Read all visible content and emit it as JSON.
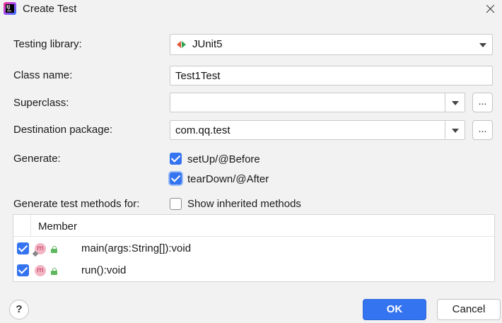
{
  "window": {
    "title": "Create Test",
    "app_icon": "intellij-idea-icon",
    "app_icon_text": "IJ"
  },
  "form": {
    "testing_library_label": "Testing library:",
    "testing_library_value": "JUnit5",
    "class_name_label": "Class name:",
    "class_name_value": "Test1Test",
    "superclass_label": "Superclass:",
    "superclass_value": "",
    "destination_package_label": "Destination package:",
    "destination_package_value": "com.qq.test",
    "browse_label": "...",
    "generate_label": "Generate:",
    "setup_label": "setUp/@Before",
    "setup_checked": true,
    "teardown_label": "tearDown/@After",
    "teardown_checked": true,
    "generate_methods_label": "Generate test methods for:",
    "show_inherited_label": "Show inherited methods",
    "show_inherited_checked": false
  },
  "members_table": {
    "header": "Member",
    "rows": [
      {
        "checked": true,
        "icon": "method-icon",
        "icon_text": "m",
        "static": true,
        "visibility": "public-lock-icon",
        "name": "main(args:String[]):void"
      },
      {
        "checked": true,
        "icon": "method-icon",
        "icon_text": "m",
        "static": false,
        "visibility": "public-lock-icon",
        "name": "run():void"
      }
    ]
  },
  "footer": {
    "help_label": "?",
    "ok_label": "OK",
    "cancel_label": "Cancel"
  },
  "colors": {
    "accent": "#3574f0",
    "method_icon_bg": "#f3b5c4",
    "lock_green": "#5fb85f"
  }
}
